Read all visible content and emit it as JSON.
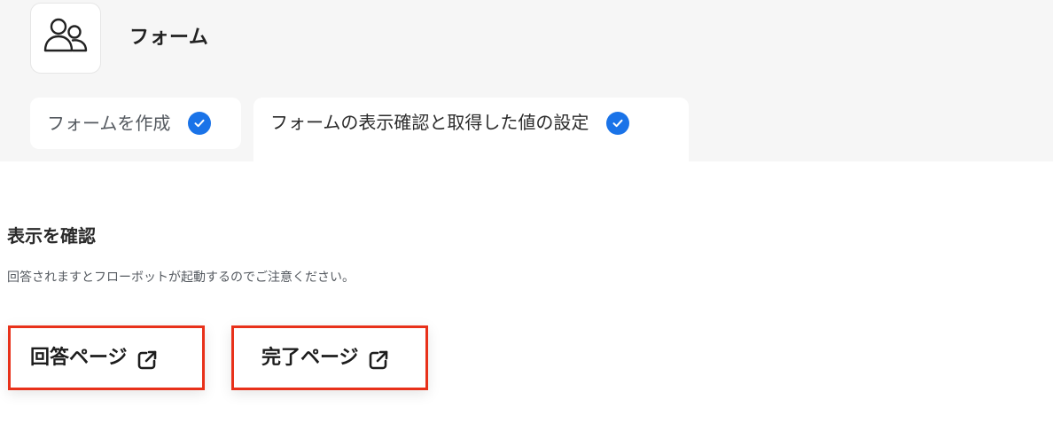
{
  "header": {
    "app_icon": "users-icon",
    "title": "フォーム"
  },
  "tabs": [
    {
      "label": "フォームを作成",
      "completed": true,
      "icon": "check-circle-icon"
    },
    {
      "label": "フォームの表示確認と取得した値の設定",
      "completed": true,
      "active": true,
      "icon": "check-circle-icon"
    }
  ],
  "section": {
    "title": "表示を確認",
    "description": "回答されますとフローボットが起動するのでご注意ください。"
  },
  "buttons": {
    "answer_page": {
      "label": "回答ページ",
      "icon": "external-link-icon"
    },
    "complete_page": {
      "label": "完了ページ",
      "icon": "external-link-icon"
    }
  },
  "colors": {
    "accent": "#1a73e8",
    "highlight_border": "#e8311a",
    "top_background": "#f6f6f6"
  }
}
